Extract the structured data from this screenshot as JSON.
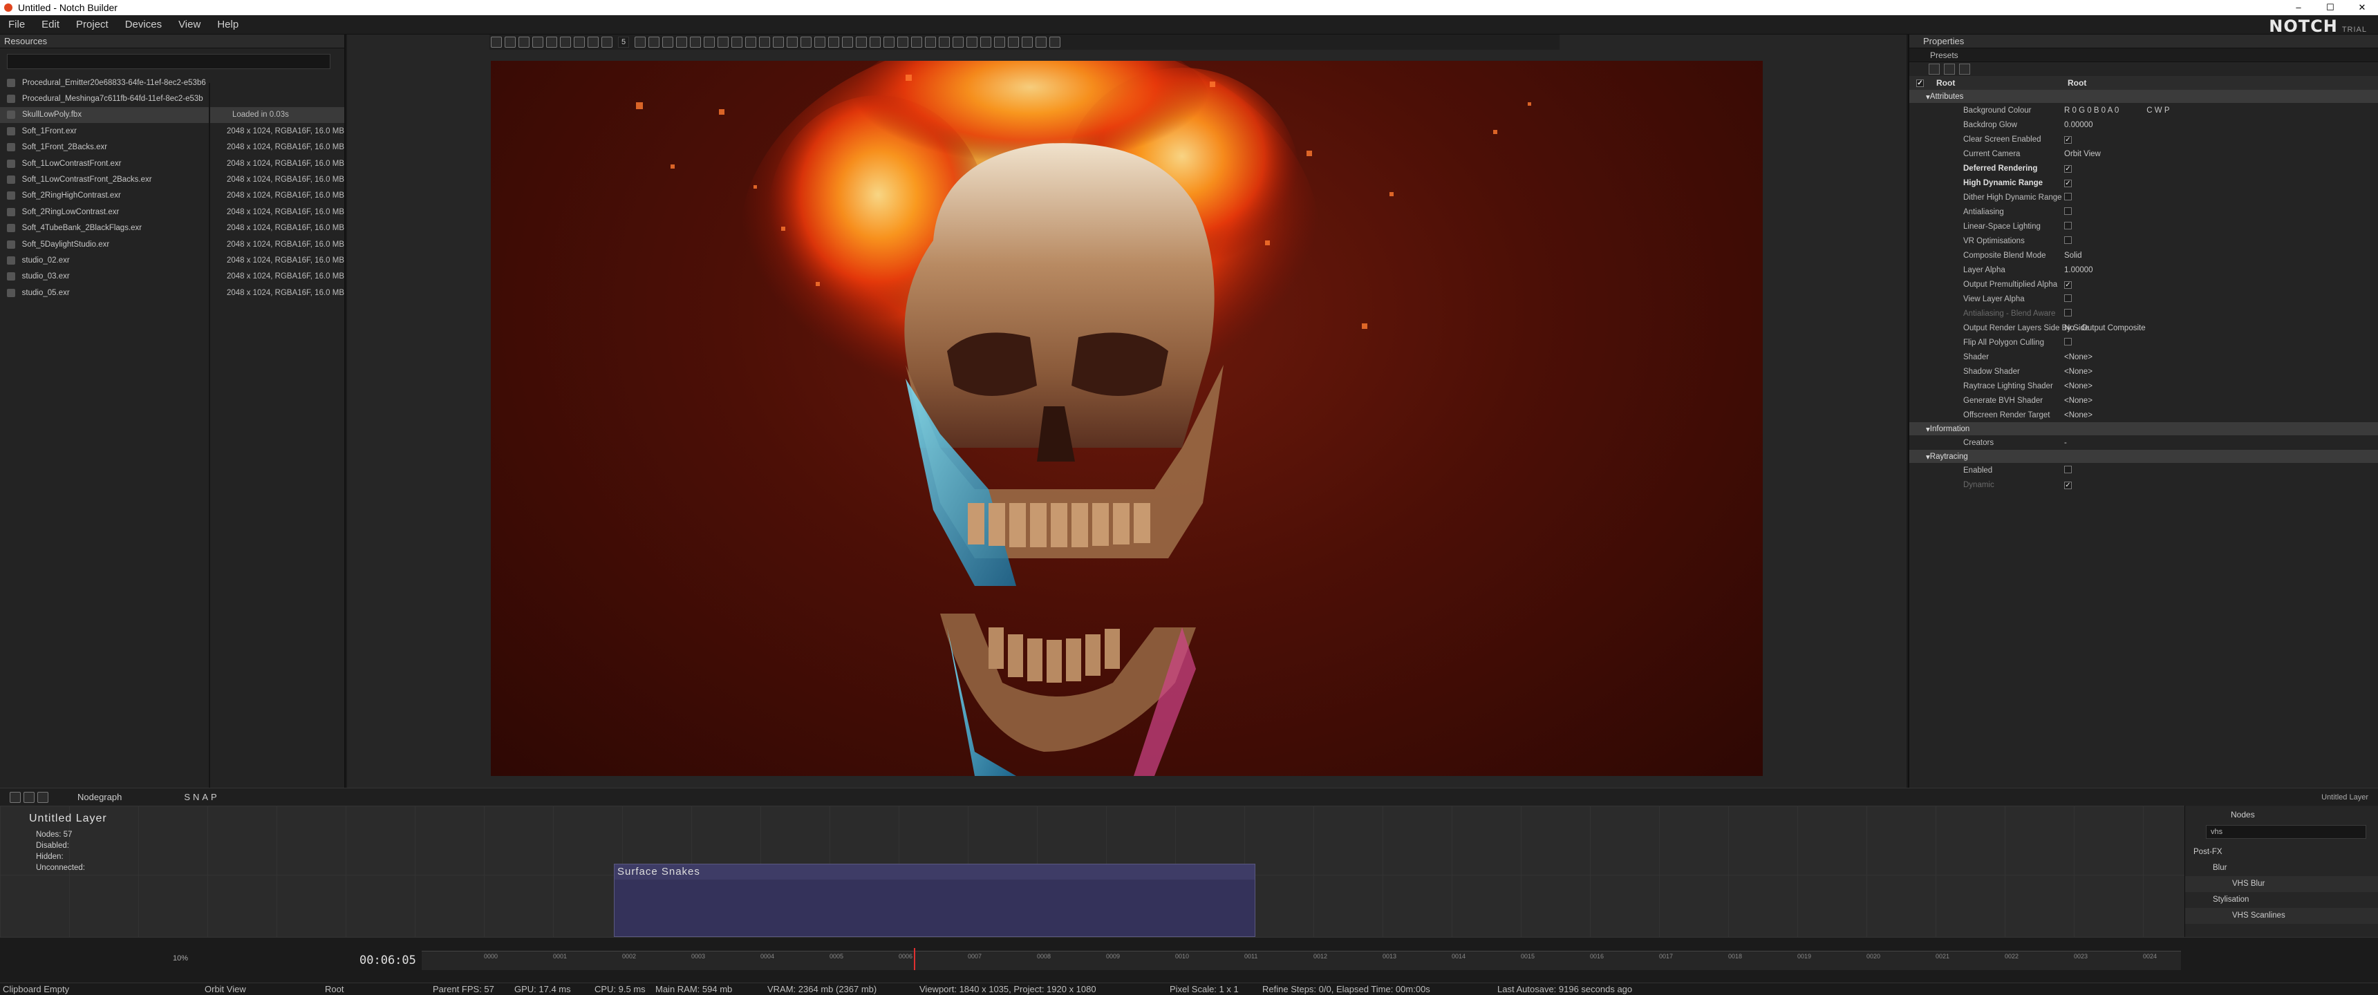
{
  "window": {
    "title": "Untitled - Notch Builder"
  },
  "menu": [
    "File",
    "Edit",
    "Project",
    "Devices",
    "View",
    "Help"
  ],
  "logo": {
    "brand": "NOTCH",
    "edition": "TRIAL"
  },
  "resources": {
    "header": "Resources",
    "items": [
      {
        "name": "Procedural_Emitter20e68833-64fe-11ef-8ec2-e53b6",
        "info": ""
      },
      {
        "name": "Procedural_Meshinga7c611fb-64fd-11ef-8ec2-e53b",
        "info": ""
      },
      {
        "name": "SkullLowPoly.fbx",
        "info": "Loaded in 0.03s"
      },
      {
        "name": "Soft_1Front.exr",
        "info": "2048 x 1024, RGBA16F, 16.0 MB"
      },
      {
        "name": "Soft_1Front_2Backs.exr",
        "info": "2048 x 1024, RGBA16F, 16.0 MB"
      },
      {
        "name": "Soft_1LowContrastFront.exr",
        "info": "2048 x 1024, RGBA16F, 16.0 MB"
      },
      {
        "name": "Soft_1LowContrastFront_2Backs.exr",
        "info": "2048 x 1024, RGBA16F, 16.0 MB"
      },
      {
        "name": "Soft_2RingHighContrast.exr",
        "info": "2048 x 1024, RGBA16F, 16.0 MB"
      },
      {
        "name": "Soft_2RingLowContrast.exr",
        "info": "2048 x 1024, RGBA16F, 16.0 MB"
      },
      {
        "name": "Soft_4TubeBank_2BlackFlags.exr",
        "info": "2048 x 1024, RGBA16F, 16.0 MB"
      },
      {
        "name": "Soft_5DaylightStudio.exr",
        "info": "2048 x 1024, RGBA16F, 16.0 MB"
      },
      {
        "name": "studio_02.exr",
        "info": "2048 x 1024, RGBA16F, 16.0 MB"
      },
      {
        "name": "studio_03.exr",
        "info": "2048 x 1024, RGBA16F, 16.0 MB"
      },
      {
        "name": "studio_05.exr",
        "info": "2048 x 1024, RGBA16F, 16.0 MB"
      }
    ]
  },
  "viewport_toolbar": {
    "frame_field": "5"
  },
  "properties": {
    "header": "Properties",
    "presets": "Presets",
    "root_label": "Root",
    "root_value": "Root",
    "groups": {
      "attributes": "Attributes",
      "information": "Information",
      "raytracing": "Raytracing"
    },
    "attributes": [
      {
        "label": "Background Colour",
        "value": "R 0 G 0 B 0 A 0",
        "extra": "C  W  P",
        "style": "normal"
      },
      {
        "label": "Backdrop Glow",
        "value": "0.00000",
        "style": "normal"
      },
      {
        "label": "Clear Screen Enabled",
        "value": "✓",
        "style": "normal"
      },
      {
        "label": "Current Camera",
        "value": "Orbit View",
        "style": "normal"
      },
      {
        "label": "Deferred Rendering",
        "value": "✓",
        "style": "bold"
      },
      {
        "label": "High Dynamic Range",
        "value": "✓",
        "style": "bold"
      },
      {
        "label": "Dither High Dynamic Range",
        "value": "",
        "style": "normal"
      },
      {
        "label": "Antialiasing",
        "value": "",
        "style": "normal"
      },
      {
        "label": "Linear-Space Lighting",
        "value": "",
        "style": "normal"
      },
      {
        "label": "VR Optimisations",
        "value": "",
        "style": "normal"
      },
      {
        "label": "Composite Blend Mode",
        "value": "Solid",
        "style": "normal"
      },
      {
        "label": "Layer Alpha",
        "value": "1.00000",
        "style": "normal"
      },
      {
        "label": "Output Premultiplied Alpha",
        "value": "✓",
        "style": "normal"
      },
      {
        "label": "View Layer Alpha",
        "value": "",
        "style": "normal"
      },
      {
        "label": "Antialiasing - Blend Aware",
        "value": "",
        "style": "dim"
      },
      {
        "label": "Output Render Layers Side By Side",
        "value": "No - Output Composite",
        "style": "normal"
      },
      {
        "label": "Flip All Polygon Culling",
        "value": "",
        "style": "normal"
      },
      {
        "label": "Shader",
        "value": "<None>",
        "style": "normal"
      },
      {
        "label": "Shadow Shader",
        "value": "<None>",
        "style": "normal"
      },
      {
        "label": "Raytrace Lighting Shader",
        "value": "<None>",
        "style": "normal"
      },
      {
        "label": "Generate BVH Shader",
        "value": "<None>",
        "style": "normal"
      },
      {
        "label": "Offscreen Render Target",
        "value": "<None>",
        "style": "normal"
      }
    ],
    "information": [
      {
        "label": "Creators",
        "value": "-",
        "style": "normal"
      }
    ],
    "raytracing": [
      {
        "label": "Enabled",
        "value": "",
        "style": "normal"
      },
      {
        "label": "Dynamic",
        "value": "✓",
        "style": "dim"
      }
    ]
  },
  "nodegraph": {
    "tab": "Nodegraph",
    "snap_label": "SNAP",
    "layer_title": "Untitled  Layer",
    "stats": [
      "Nodes:  57",
      "Disabled:",
      "Hidden:",
      "Unconnected:"
    ],
    "group_node": "Surface  Snakes",
    "right_label": "Untitled Layer"
  },
  "nodes_panel": {
    "tab": "Nodes",
    "search": "vhs",
    "tree": [
      {
        "label": "Post-FX",
        "level": 0
      },
      {
        "label": "Blur",
        "level": 1
      },
      {
        "label": "VHS Blur",
        "level": 2
      },
      {
        "label": "Stylisation",
        "level": 1
      },
      {
        "label": "VHS Scanlines",
        "level": 2
      }
    ]
  },
  "timeline": {
    "timecode": "00:06:05",
    "ticks": [
      "0000",
      "0001",
      "0002",
      "0003",
      "0004",
      "0005",
      "0006",
      "0007",
      "0008",
      "0009",
      "0010",
      "0011",
      "0012",
      "0013",
      "0014",
      "0015",
      "0016",
      "0017",
      "0018",
      "0019",
      "0020",
      "0021",
      "0022",
      "0023",
      "0024"
    ],
    "zoom": "10%"
  },
  "status": {
    "clipboard": "Clipboard Empty",
    "camera": "Orbit View",
    "layer": "Root",
    "parent_fps": "Parent  FPS: 57",
    "gpu": "GPU: 17.4 ms",
    "cpu": "CPU: 9.5 ms",
    "ram": "Main RAM: 594 mb",
    "vram": "VRAM: 2364 mb (2367 mb)",
    "viewport": "Viewport: 1840 x 1035, Project: 1920 x 1080",
    "pixel_scale": "Pixel Scale: 1 x 1",
    "refine": "Refine Steps: 0/0, Elapsed Time: 00m:00s",
    "autosave": "Last Autosave: 9196 seconds ago"
  }
}
